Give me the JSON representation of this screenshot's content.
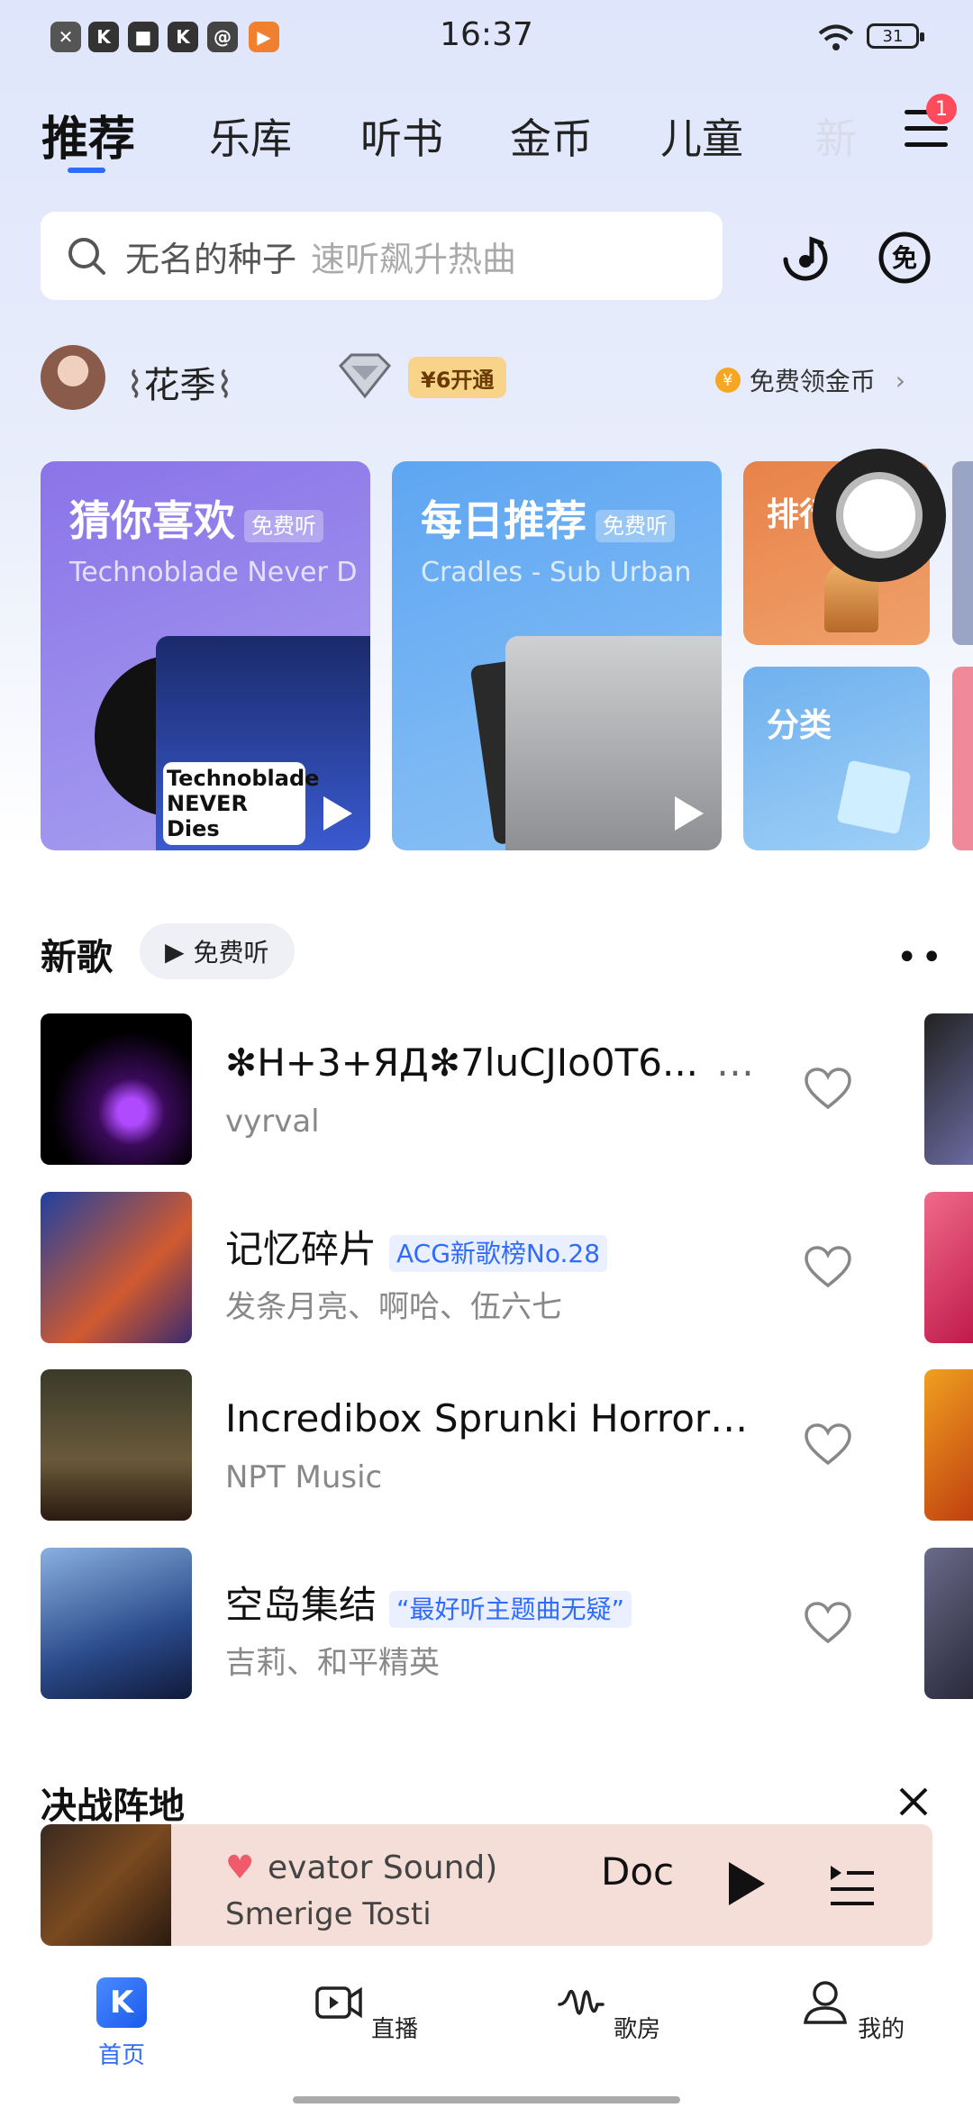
{
  "status_bar": {
    "time": "16:37",
    "battery": "31"
  },
  "top_tabs": [
    "推荐",
    "乐库",
    "听书",
    "金币",
    "儿童",
    "新"
  ],
  "menu_badge": "1",
  "search": {
    "query": "无名的种子",
    "hint": "速听飙升热曲"
  },
  "user": {
    "name": "花季",
    "vip_label": "¥6开通",
    "gold_link": "免费领金币"
  },
  "cards": [
    {
      "title": "猜你喜欢",
      "tag": "免费听",
      "subtitle": "Technoblade Never D",
      "cover_text": "Technoblade NEVER Dies"
    },
    {
      "title": "每日推荐",
      "tag": "免费听",
      "subtitle": "Cradles - Sub Urban"
    },
    {
      "title": "排行"
    },
    {
      "title": "分类"
    }
  ],
  "new_songs": {
    "title": "新歌",
    "free_label": "免费听",
    "items": [
      {
        "title": "✻H+3+ЯД✻7luCJIo0T6...",
        "artist": "vyrval",
        "tag": ""
      },
      {
        "title": "记忆碎片",
        "artist": "发条月亮、啊哈、伍六七",
        "tag": "ACG新歌榜No.28"
      },
      {
        "title": "Incredibox Sprunki Horror…",
        "artist": "NPT Music",
        "tag": ""
      },
      {
        "title": "空岛集结",
        "artist": "吉莉、和平精英",
        "tag": "“最好听主题曲无疑”"
      }
    ]
  },
  "next_section": {
    "title": "决战阵地"
  },
  "player": {
    "title": "evator Sound)",
    "title_right": "Doc",
    "artist": "Smerige Tosti"
  },
  "bottom_nav": [
    "首页",
    "直播",
    "歌房",
    "我的"
  ],
  "colors": {
    "accent": "#2f6bff",
    "badge": "#ff4b5c",
    "vip": "#f7d48a"
  }
}
